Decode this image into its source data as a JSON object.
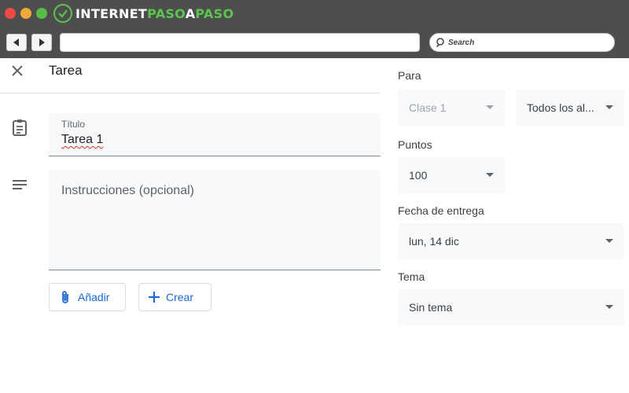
{
  "browser": {
    "logo_part1": "INTERNET",
    "logo_part2": "PASO",
    "logo_part3": "A",
    "logo_part4": "PASO",
    "search_placeholder": "Search"
  },
  "header": {
    "title": "Tarea"
  },
  "form": {
    "title_label": "Título",
    "title_value": "Tarea 1",
    "instructions_placeholder": "Instrucciones (opcional)",
    "add_button": "Añadir",
    "create_button": "Crear"
  },
  "settings": {
    "for_label": "Para",
    "class_value": "Clase 1",
    "students_value": "Todos los al...",
    "points_label": "Puntos",
    "points_value": "100",
    "due_label": "Fecha de entrega",
    "due_value": "lun, 14 dic",
    "topic_label": "Tema",
    "topic_value": "Sin tema"
  },
  "colors": {
    "accent": "#1967d2",
    "logo_green": "#5cc44f",
    "chrome": "#4e4e4e",
    "field_bg": "#f8f9fa"
  },
  "icons": [
    "close-icon",
    "assignment-clipboard-icon",
    "notes-lines-icon",
    "attachment-clip-icon",
    "plus-icon",
    "back-arrow-icon",
    "forward-arrow-icon",
    "search-icon"
  ]
}
